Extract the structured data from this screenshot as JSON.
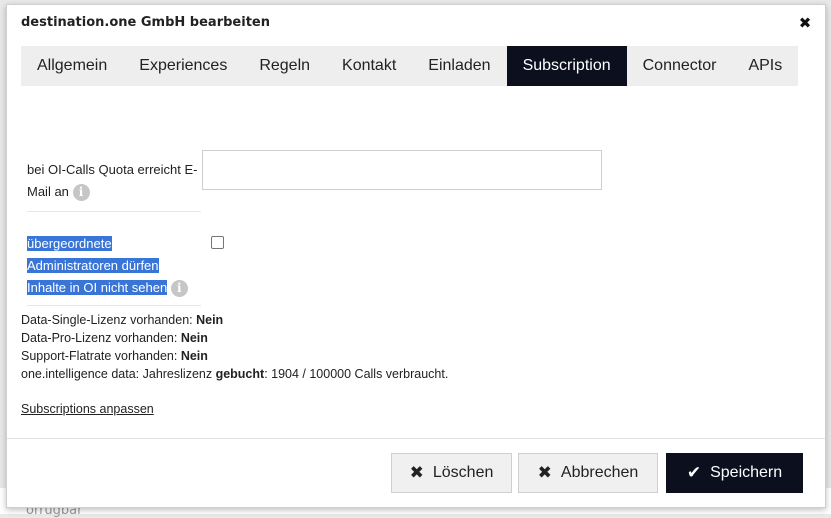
{
  "background": {
    "text": "orrugbar"
  },
  "modal": {
    "title": "destination.one GmbH bearbeiten",
    "close_symbol": "✖"
  },
  "tabs": [
    {
      "label": "Allgemein",
      "active": false
    },
    {
      "label": "Experiences",
      "active": false
    },
    {
      "label": "Regeln",
      "active": false
    },
    {
      "label": "Kontakt",
      "active": false
    },
    {
      "label": "Einladen",
      "active": false
    },
    {
      "label": "Subscription",
      "active": true
    },
    {
      "label": "Connector",
      "active": false
    },
    {
      "label": "APIs",
      "active": false
    }
  ],
  "form": {
    "quota_email_label": "bei OI-Calls Quota erreicht E-Mail an",
    "quota_email_value": "",
    "admin_hide_label_line1": "übergeordnete",
    "admin_hide_label_line2": "Administratoren dürfen",
    "admin_hide_label_line3": "Inhalte in OI nicht sehen",
    "admin_hide_checked": false
  },
  "info": {
    "single_label": "Data-Single-Lizenz vorhanden: ",
    "single_value": "Nein",
    "pro_label": "Data-Pro-Lizenz vorhanden: ",
    "pro_value": "Nein",
    "support_label": "Support-Flatrate vorhanden: ",
    "support_value": "Nein",
    "oi_prefix": "one.intelligence data: Jahreslizenz ",
    "oi_bold": "gebucht",
    "oi_suffix": ": 1904 / 100000 Calls verbraucht."
  },
  "link": {
    "subscriptions": "Subscriptions anpassen"
  },
  "buttons": {
    "delete": "Löschen",
    "cancel": "Abbrechen",
    "save": "Speichern"
  },
  "colors": {
    "active_tab": "#0b0f1e",
    "selection": "#3875d7",
    "save_button": "#0b0f1e"
  }
}
